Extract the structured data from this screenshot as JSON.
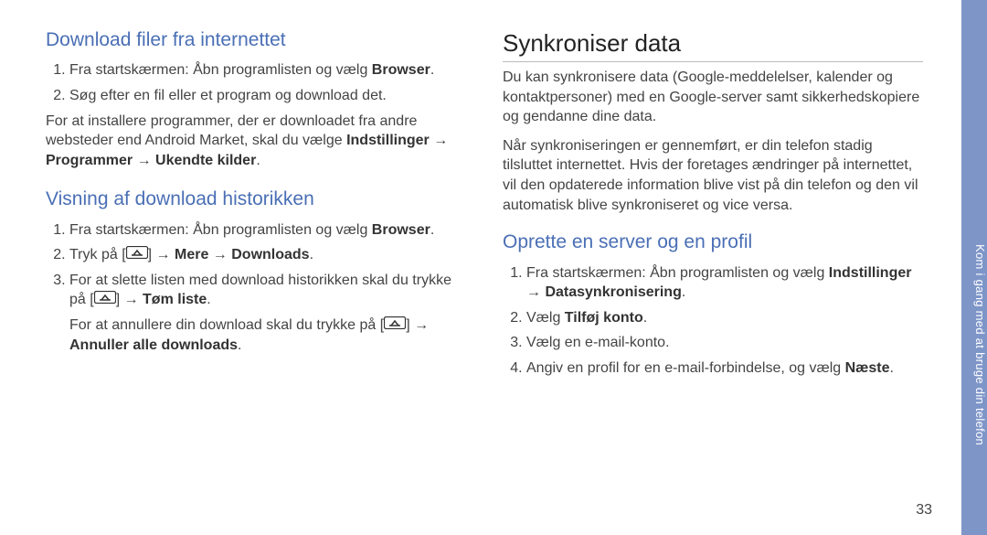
{
  "sidebar_label": "Kom i gang med at bruge din telefon",
  "page_number": "33",
  "arrow": " → ",
  "icon_alt": "menu-key-icon",
  "left": {
    "sec1": {
      "heading": "Download filer fra internettet",
      "li1a": "Fra startskærmen: Åbn programlisten og vælg ",
      "li1b": "Browser",
      "li1c": ".",
      "li2": "Søg efter en fil eller et program og download det.",
      "p1a": "For at installere programmer, der er downloadet fra andre websteder end Android Market, skal du vælge ",
      "p1b": "Indstillinger",
      "p1c": "Programmer",
      "p1d": "Ukendte kilder",
      "p1e": "."
    },
    "sec2": {
      "heading": "Visning af download historikken",
      "li1a": "Fra startskærmen: Åbn programlisten og vælg ",
      "li1b": "Browser",
      "li1c": ".",
      "li2a": "Tryk på [",
      "li2b": "] ",
      "li2c": "Mere",
      "li2d": "Downloads",
      "li2e": ".",
      "li3a": "For at slette listen med download historikken skal du trykke på [",
      "li3b": "] ",
      "li3c": "Tøm liste",
      "li3d": ".",
      "p2a": "For at annullere din download skal du trykke på [",
      "p2b": "] ",
      "p2c": "Annuller alle downloads",
      "p2d": "."
    }
  },
  "right": {
    "title": "Synkroniser data",
    "intro": "Du kan synkronisere data (Google-meddelelser, kalender og kontaktpersoner) med en Google-server samt sikkerhedskopiere og gendanne dine data.",
    "intro2": "Når synkroniseringen er gennemført, er din telefon stadig tilsluttet internettet. Hvis der foretages ændringer på internettet, vil den opdaterede information blive vist på din telefon og den vil automatisk blive synkroniseret og vice versa.",
    "sec1": {
      "heading": "Oprette en server og en profil",
      "li1a": "Fra startskærmen: Åbn programlisten og vælg ",
      "li1b": "Indstillinger",
      "li1c": "Datasynkronisering",
      "li1d": ".",
      "li2a": "Vælg ",
      "li2b": "Tilføj konto",
      "li2c": ".",
      "li3": "Vælg en e-mail-konto.",
      "li4a": "Angiv en profil for en e-mail-forbindelse, og vælg ",
      "li4b": "Næste",
      "li4c": "."
    }
  }
}
